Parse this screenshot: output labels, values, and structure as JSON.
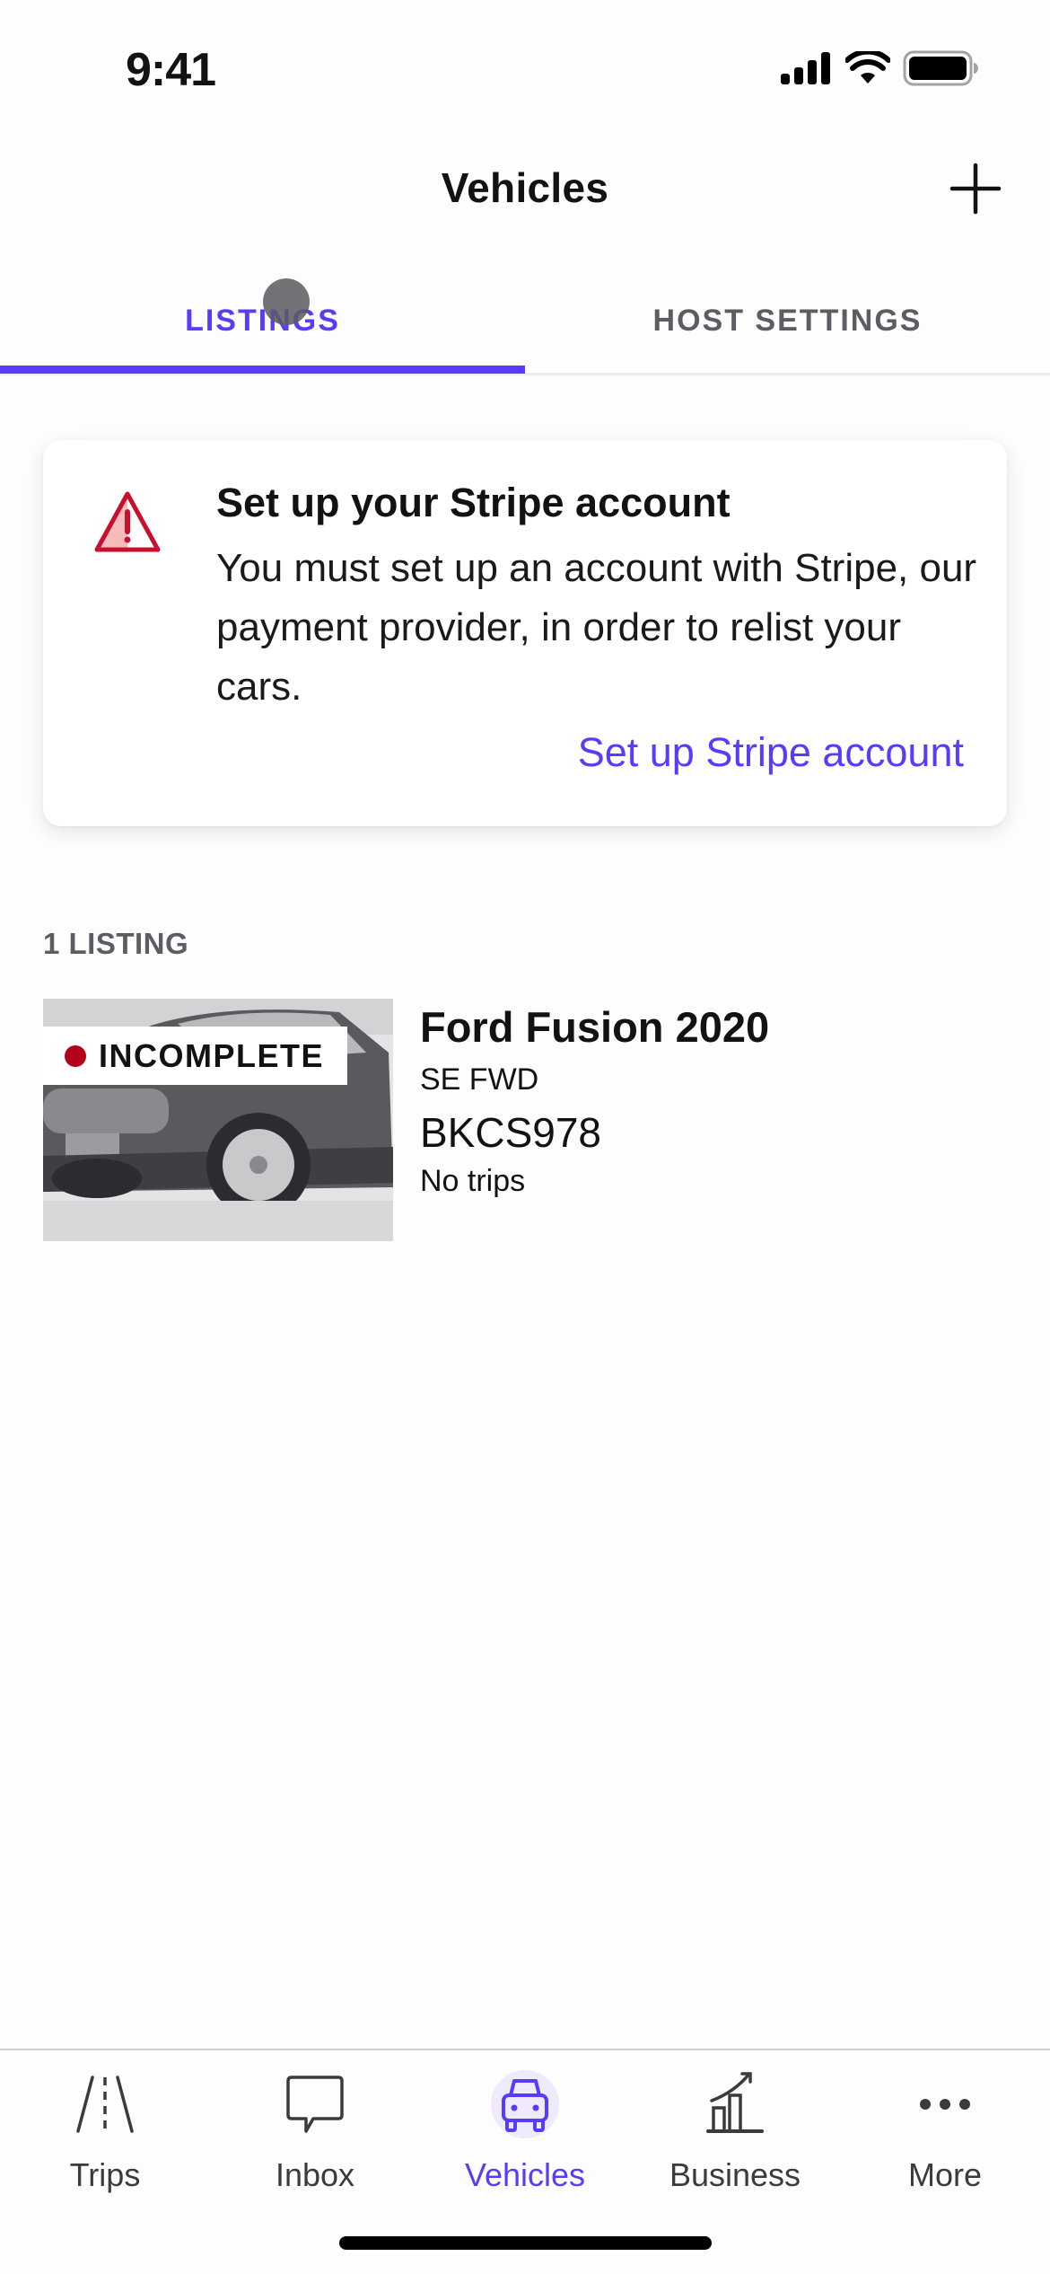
{
  "status_bar": {
    "time": "9:41"
  },
  "header": {
    "title": "Vehicles",
    "add_icon": "plus-icon"
  },
  "tabs": [
    {
      "label": "LISTINGS",
      "active": true
    },
    {
      "label": "HOST SETTINGS",
      "active": false
    }
  ],
  "alert": {
    "icon": "warning-triangle-icon",
    "title": "Set up your Stripe account",
    "body": "You must set up an account with Stripe, our payment provider, in order to relist your cars.",
    "link_label": "Set up Stripe account"
  },
  "listings": {
    "count_label": "1 LISTING",
    "items": [
      {
        "status": "INCOMPLETE",
        "status_color": "#b5001b",
        "name": "Ford Fusion 2020",
        "trim": "SE FWD",
        "plate": "BKCS978",
        "trips": "No trips"
      }
    ]
  },
  "tab_bar": {
    "items": [
      {
        "label": "Trips",
        "icon": "road-icon",
        "active": false
      },
      {
        "label": "Inbox",
        "icon": "chat-bubble-icon",
        "active": false
      },
      {
        "label": "Vehicles",
        "icon": "car-icon",
        "active": true
      },
      {
        "label": "Business",
        "icon": "chart-growth-icon",
        "active": false
      },
      {
        "label": "More",
        "icon": "more-dots-icon",
        "active": false
      }
    ]
  },
  "colors": {
    "accent": "#593cfb",
    "warning": "#c8102e",
    "text": "#121214",
    "muted": "#5c5c63"
  }
}
